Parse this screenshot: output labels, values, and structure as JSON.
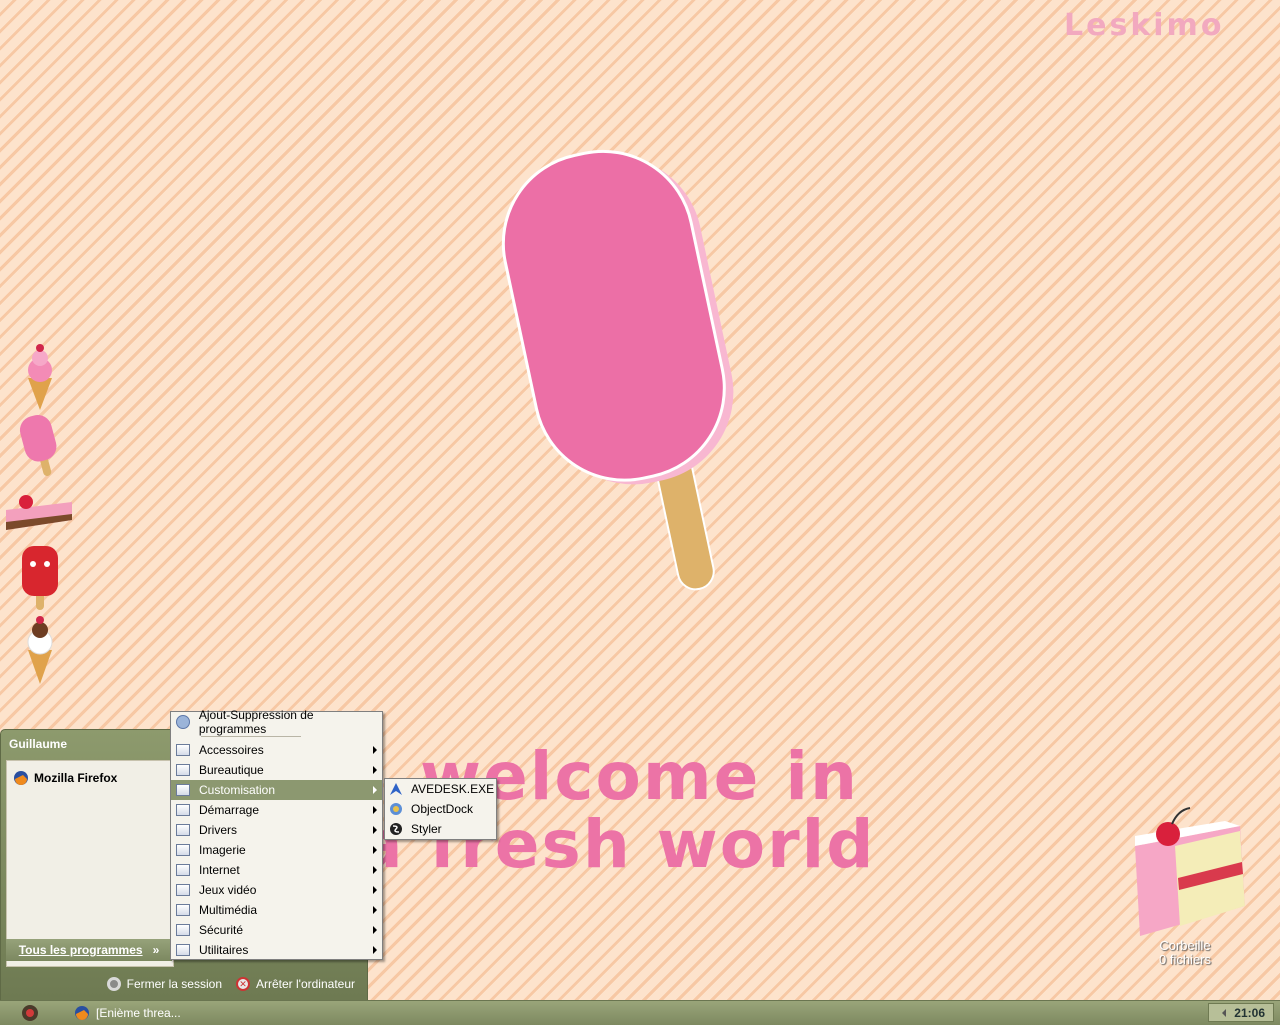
{
  "desktop": {
    "brand": "Leskimo",
    "welcome_line1": "welcome in",
    "welcome_line2": "a fresh world",
    "recycle_bin": {
      "name": "Corbeille",
      "count": "0 fichiers"
    }
  },
  "start_menu": {
    "user": "Guillaume",
    "pinned": [
      {
        "label": "Mozilla Firefox",
        "icon": "firefox-icon"
      }
    ],
    "all_programs": "Tous les programmes",
    "logoff": "Fermer la session",
    "shutdown": "Arrêter l'ordinateur"
  },
  "programs_menu": {
    "top_item": "Ajout-Suppression de programmes",
    "items": [
      {
        "label": "Accessoires"
      },
      {
        "label": "Bureautique"
      },
      {
        "label": "Customisation",
        "selected": true
      },
      {
        "label": "Démarrage"
      },
      {
        "label": "Drivers"
      },
      {
        "label": "Imagerie"
      },
      {
        "label": "Internet"
      },
      {
        "label": "Jeux vidéo"
      },
      {
        "label": "Multimédia"
      },
      {
        "label": "Sécurité"
      },
      {
        "label": "Utilitaires"
      }
    ]
  },
  "customisation_submenu": {
    "items": [
      {
        "label": "AVEDESK.EXE",
        "icon": "avedesk-icon"
      },
      {
        "label": "ObjectDock",
        "icon": "objectdock-icon"
      },
      {
        "label": "Styler",
        "icon": "styler-icon"
      }
    ]
  },
  "taskbar": {
    "task_label": "[Enième threa...",
    "clock": "21:06"
  },
  "colors": {
    "accent": "#8c9870",
    "popsicle_pink": "#ec6fa6",
    "stripe_light": "#fde3cc",
    "stripe_dark": "#f7c8a4"
  }
}
